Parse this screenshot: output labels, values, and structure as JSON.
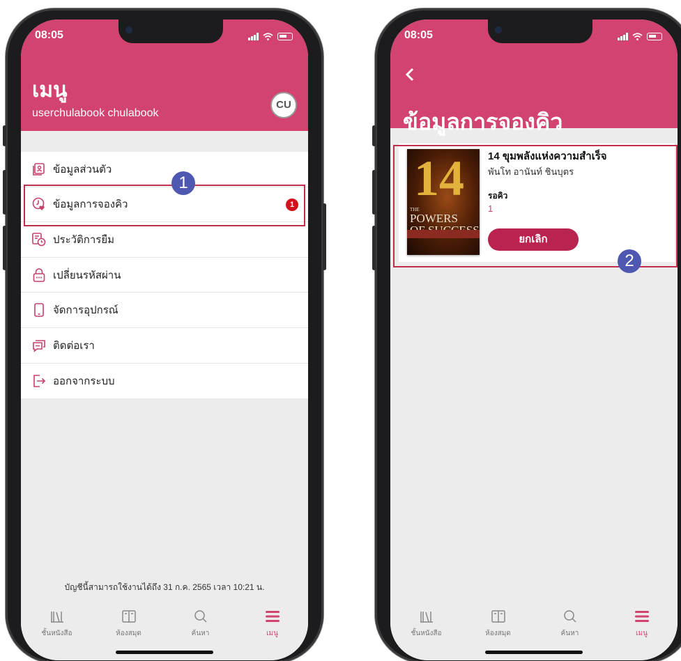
{
  "left_phone": {
    "status": {
      "time": "08:05"
    },
    "header": {
      "title": "เมนู",
      "user": "userchulabook chulabook",
      "logo_text": "CU"
    },
    "menu": [
      {
        "label": "ข้อมูลส่วนตัว",
        "icon": "profile-icon"
      },
      {
        "label": "ข้อมูลการจองคิว",
        "icon": "clock-heart-icon",
        "badge": "1"
      },
      {
        "label": "ประวัติการยืม",
        "icon": "history-icon"
      },
      {
        "label": "เปลี่ยนรหัสผ่าน",
        "icon": "lock-icon"
      },
      {
        "label": "จัดการอุปกรณ์",
        "icon": "device-icon"
      },
      {
        "label": "ติดต่อเรา",
        "icon": "chat-icon"
      },
      {
        "label": "ออกจากระบบ",
        "icon": "logout-icon"
      }
    ],
    "marker": "1",
    "footer_note": "บัญชีนี้สามารถใช้งานได้ถึง 31 ก.ค. 2565 เวลา 10:21 น."
  },
  "right_phone": {
    "status": {
      "time": "08:05"
    },
    "title": "ข้อมูลการจองคิว",
    "booking": {
      "cover": {
        "number": "14",
        "the": "THE",
        "line1": "POWERS",
        "line2": "OF SUCCESS"
      },
      "title": "14 ขุมพลังแห่งความสำเร็จ",
      "author": "พันโท อานันท์ ชินบุตร",
      "status_label": "รอคิว",
      "status_value": "1",
      "cancel_label": "ยกเลิก"
    },
    "marker": "2"
  },
  "tabbar": [
    {
      "label": "ชั้นหนังสือ",
      "icon": "bookshelf-icon"
    },
    {
      "label": "ห้องสมุด",
      "icon": "library-icon"
    },
    {
      "label": "ค้นหา",
      "icon": "search-icon"
    },
    {
      "label": "เมนู",
      "icon": "menu-icon",
      "active": true
    }
  ],
  "colors": {
    "brand": "#d2436f",
    "highlight": "#c0304e",
    "marker": "#4f58b0",
    "badge": "#d1141b",
    "button": "#b8234f"
  }
}
